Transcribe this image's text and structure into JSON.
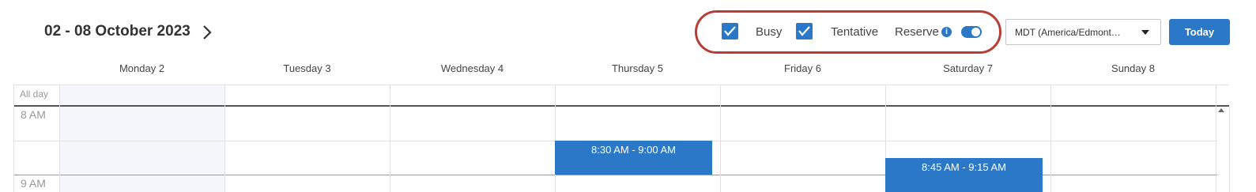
{
  "header": {
    "date_range": "02 - 08 October 2023",
    "next_icon": "chevron-right-icon"
  },
  "filters": {
    "busy": {
      "label": "Busy",
      "checked": true
    },
    "tentative": {
      "label": "Tentative",
      "checked": true
    },
    "reserve": {
      "label": "Reserve",
      "info_icon": "info-icon",
      "toggle_on": true
    },
    "highlight_color": "#b83d35"
  },
  "timezone": {
    "selected": "MDT (America/Edmont…",
    "icon": "caret-down-icon"
  },
  "today_button": {
    "label": "Today"
  },
  "days": [
    {
      "label": "Monday 2"
    },
    {
      "label": "Tuesday 3"
    },
    {
      "label": "Wednesday 4"
    },
    {
      "label": "Thursday 5"
    },
    {
      "label": "Friday 6"
    },
    {
      "label": "Saturday 7"
    },
    {
      "label": "Sunday 8"
    }
  ],
  "grid": {
    "all_day_label": "All day",
    "time_labels": [
      "8 AM",
      "9 AM"
    ]
  },
  "events": [
    {
      "day": "Thursday 5",
      "time": "8:30 AM - 9:00 AM"
    },
    {
      "day": "Saturday 7",
      "time": "8:45 AM - 9:15 AM"
    }
  ],
  "colors": {
    "accent": "#2b78c8",
    "today_shade": "#f5f7fd",
    "grid_line": "#e2e2e2"
  }
}
